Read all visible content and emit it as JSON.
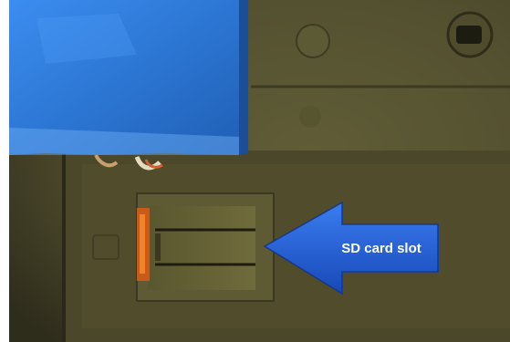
{
  "callout": {
    "label": "SD card slot",
    "arrow_color": "#1e5bd6",
    "text_color": "#ffffff"
  },
  "scene": {
    "device_body_color": "#4a4a2a",
    "blue_pack_color": "#2e7fd8"
  }
}
